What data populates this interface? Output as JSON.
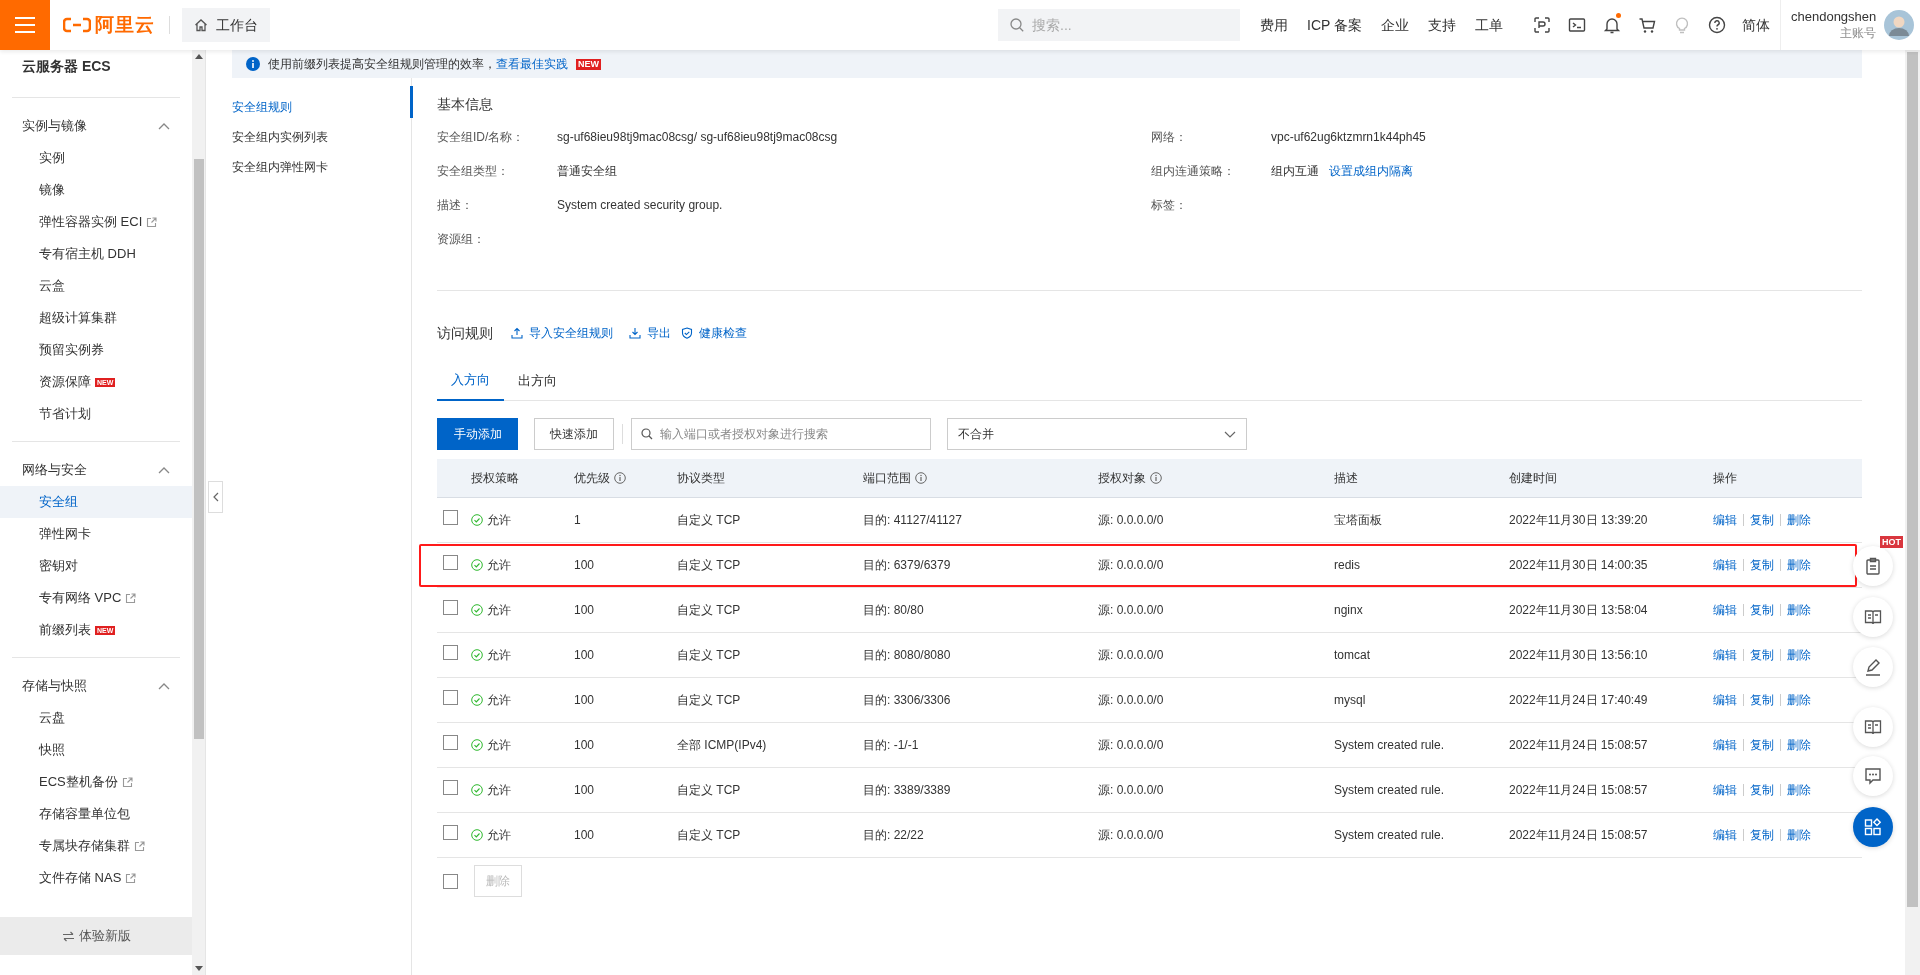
{
  "header": {
    "logo": "阿里云",
    "workbench": "工作台",
    "search": {
      "placeholder": "搜索..."
    },
    "nav": [
      "费用",
      "ICP 备案",
      "企业",
      "支持",
      "工单"
    ],
    "tools": [
      {
        "kind": "scan",
        "dot": false
      },
      {
        "kind": "terminal",
        "dot": false
      },
      {
        "kind": "bell",
        "dot": true
      },
      {
        "kind": "cart",
        "dot": false
      },
      {
        "kind": "bulb",
        "dot": false
      },
      {
        "kind": "help",
        "dot": false
      }
    ],
    "language": "简体",
    "user": {
      "name": "chendongshen",
      "role": "主账号"
    }
  },
  "sidebar": {
    "title": "云服务器 ECS",
    "groups": [
      {
        "label": "实例与镜像",
        "expanded": true,
        "items": [
          {
            "label": "实例",
            "selected": false,
            "external": false
          },
          {
            "label": "镜像",
            "selected": false,
            "external": false
          },
          {
            "label": "弹性容器实例 ECI",
            "selected": false,
            "external": true
          },
          {
            "label": "专有宿主机 DDH",
            "selected": false,
            "external": false
          },
          {
            "label": "云盒",
            "selected": false,
            "external": false
          },
          {
            "label": "超级计算集群",
            "selected": false,
            "external": false
          },
          {
            "label": "预留实例券",
            "selected": false,
            "external": false
          },
          {
            "label": "资源保障",
            "selected": false,
            "external": false,
            "badge": "NEW"
          },
          {
            "label": "节省计划",
            "selected": false,
            "external": false
          }
        ]
      },
      {
        "label": "网络与安全",
        "expanded": true,
        "items": [
          {
            "label": "安全组",
            "selected": true,
            "external": false
          },
          {
            "label": "弹性网卡",
            "selected": false,
            "external": false
          },
          {
            "label": "密钥对",
            "selected": false,
            "external": false
          },
          {
            "label": "专有网络 VPC",
            "selected": false,
            "external": true
          },
          {
            "label": "前缀列表",
            "selected": false,
            "external": false,
            "badge": "NEW"
          }
        ]
      },
      {
        "label": "存储与快照",
        "expanded": true,
        "items": [
          {
            "label": "云盘",
            "selected": false,
            "external": false
          },
          {
            "label": "快照",
            "selected": false,
            "external": false
          },
          {
            "label": "ECS整机备份",
            "selected": false,
            "external": true
          },
          {
            "label": "存储容量单位包",
            "selected": false,
            "external": false
          },
          {
            "label": "专属块存储集群",
            "selected": false,
            "external": true
          },
          {
            "label": "文件存储 NAS",
            "selected": false,
            "external": true
          }
        ]
      }
    ],
    "footer": "体验新版"
  },
  "notice": {
    "text": "使用前缀列表提高安全组规则管理的效率，",
    "link": "查看最佳实践",
    "badge": "NEW"
  },
  "subnav": [
    {
      "label": "安全组规则",
      "selected": true
    },
    {
      "label": "安全组内实例列表",
      "selected": false
    },
    {
      "label": "安全组内弹性网卡",
      "selected": false
    }
  ],
  "basic_info": {
    "title": "基本信息",
    "left": [
      {
        "label": "安全组ID/名称：",
        "value": "sg-uf68ieu98tj9mac08csg/ sg-uf68ieu98tj9mac08csg"
      },
      {
        "label": "安全组类型：",
        "value": "普通安全组"
      },
      {
        "label": "描述：",
        "value": "System created security group."
      },
      {
        "label": "资源组："
      }
    ],
    "right": [
      {
        "label": "网络：",
        "value": "vpc-uf62ug6ktzmrn1k44ph45"
      },
      {
        "label": "组内连通策略：",
        "value": "组内互通",
        "link": "设置成组内隔离"
      },
      {
        "label": "标签："
      }
    ]
  },
  "rules": {
    "title": "访问规则",
    "actions": [
      {
        "kind": "upload",
        "label": "导入安全组规则"
      },
      {
        "kind": "download",
        "label": "导出"
      },
      {
        "kind": "shield",
        "label": "健康检查"
      }
    ]
  },
  "tabs": [
    {
      "label": "入方向",
      "selected": true
    },
    {
      "label": "出方向",
      "selected": false
    }
  ],
  "toolbar": {
    "add": "手动添加",
    "quick_add": "快速添加",
    "search": {
      "placeholder": "输入端口或者授权对象进行搜索"
    },
    "merge": "不合并"
  },
  "table": {
    "columns": [
      {
        "label": "授权策略",
        "info": false
      },
      {
        "label": "优先级",
        "info": true
      },
      {
        "label": "协议类型",
        "info": false
      },
      {
        "label": "端口范围",
        "info": true
      },
      {
        "label": "授权对象",
        "info": true
      },
      {
        "label": "描述",
        "info": false
      },
      {
        "label": "创建时间",
        "info": false
      },
      {
        "label": "操作",
        "info": false
      }
    ],
    "rows": [
      {
        "checked": false,
        "highlighted": false,
        "policy": "允许",
        "priority": "1",
        "protocol": "自定义 TCP",
        "port": "目的: 41127/41127",
        "source": "源: 0.0.0.0/0",
        "description": "宝塔面板",
        "created": "2022年11月30日 13:39:20",
        "actions": [
          "编辑",
          "复制",
          "删除"
        ]
      },
      {
        "checked": false,
        "highlighted": true,
        "policy": "允许",
        "priority": "100",
        "protocol": "自定义 TCP",
        "port": "目的: 6379/6379",
        "source": "源: 0.0.0.0/0",
        "description": "redis",
        "created": "2022年11月30日 14:00:35",
        "actions": [
          "编辑",
          "复制",
          "删除"
        ]
      },
      {
        "checked": false,
        "highlighted": false,
        "policy": "允许",
        "priority": "100",
        "protocol": "自定义 TCP",
        "port": "目的: 80/80",
        "source": "源: 0.0.0.0/0",
        "description": "nginx",
        "created": "2022年11月30日 13:58:04",
        "actions": [
          "编辑",
          "复制",
          "删除"
        ]
      },
      {
        "checked": false,
        "highlighted": false,
        "policy": "允许",
        "priority": "100",
        "protocol": "自定义 TCP",
        "port": "目的: 8080/8080",
        "source": "源: 0.0.0.0/0",
        "description": "tomcat",
        "created": "2022年11月30日 13:56:10",
        "actions": [
          "编辑",
          "复制",
          "删除"
        ]
      },
      {
        "checked": false,
        "highlighted": false,
        "policy": "允许",
        "priority": "100",
        "protocol": "自定义 TCP",
        "port": "目的: 3306/3306",
        "source": "源: 0.0.0.0/0",
        "description": "mysql",
        "created": "2022年11月24日 17:40:49",
        "actions": [
          "编辑",
          "复制",
          "删除"
        ]
      },
      {
        "checked": false,
        "highlighted": false,
        "policy": "允许",
        "priority": "100",
        "protocol": "全部 ICMP(IPv4)",
        "port": "目的: -1/-1",
        "source": "源: 0.0.0.0/0",
        "description": "System created rule.",
        "created": "2022年11月24日 15:08:57",
        "actions": [
          "编辑",
          "复制",
          "删除"
        ]
      },
      {
        "checked": false,
        "highlighted": false,
        "policy": "允许",
        "priority": "100",
        "protocol": "自定义 TCP",
        "port": "目的: 3389/3389",
        "source": "源: 0.0.0.0/0",
        "description": "System created rule.",
        "created": "2022年11月24日 15:08:57",
        "actions": [
          "编辑",
          "复制",
          "删除"
        ]
      },
      {
        "checked": false,
        "highlighted": false,
        "policy": "允许",
        "priority": "100",
        "protocol": "自定义 TCP",
        "port": "目的: 22/22",
        "source": "源: 0.0.0.0/0",
        "description": "System created rule.",
        "created": "2022年11月24日 15:08:57",
        "actions": [
          "编辑",
          "复制",
          "删除"
        ]
      }
    ]
  },
  "table_footer": {
    "checked": false,
    "delete": "删除",
    "disabled": true
  },
  "float_buttons": [
    {
      "kind": "clipboard",
      "badge": "HOT"
    },
    {
      "kind": "book"
    },
    {
      "kind": "pen"
    },
    {
      "kind": "book"
    },
    {
      "kind": "chat"
    },
    {
      "kind": "apps"
    }
  ]
}
